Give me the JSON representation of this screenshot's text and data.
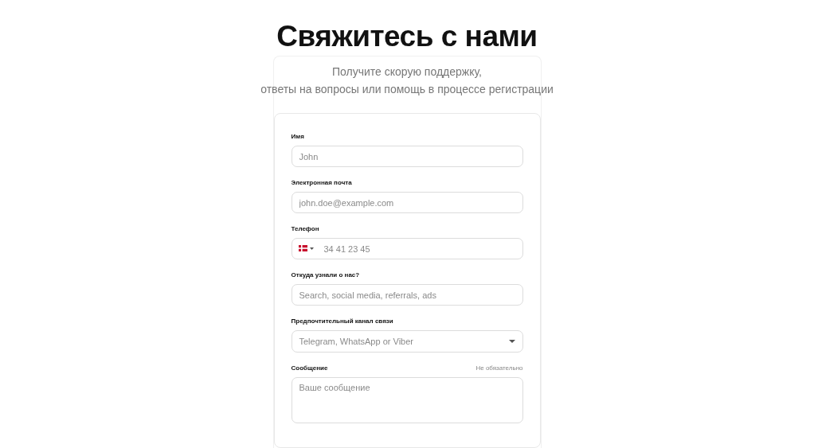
{
  "title": "Свяжитесь с нами",
  "subtitle": [
    "Получите скорую поддержку,",
    "ответы на вопросы или помощь в процессе регистрации"
  ],
  "fields": [
    {
      "kind": "text",
      "label": "Имя",
      "placeholder": "John"
    },
    {
      "kind": "text",
      "label": "Электронная почта",
      "placeholder": "john.doe@example.com"
    },
    {
      "kind": "phone",
      "label": "Телефон",
      "placeholder": "34 41 23 45"
    },
    {
      "kind": "text",
      "label": "Откуда узнали о нас?",
      "placeholder": "Search, social media, referrals, ads"
    },
    {
      "kind": "select",
      "label": "Предпочтительный канал связи",
      "placeholder": "Telegram, WhatsApp or Viber"
    },
    {
      "kind": "textarea",
      "label": "Сообщение",
      "note": "Не обязательно",
      "placeholder": "Ваше сообщение"
    }
  ]
}
